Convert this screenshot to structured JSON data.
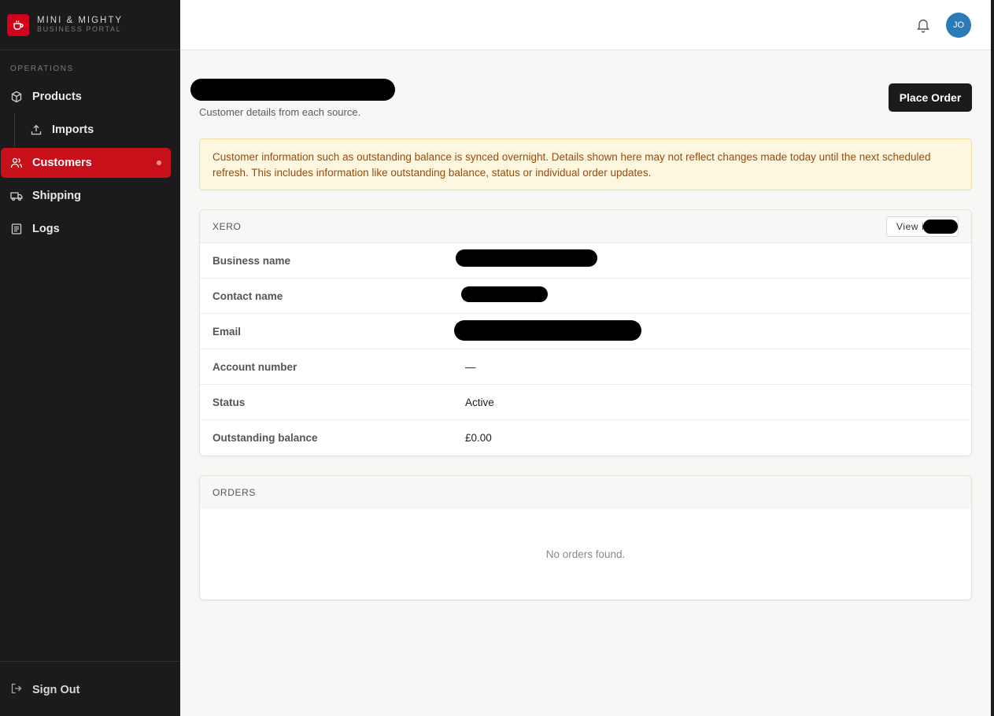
{
  "brand": {
    "title": "MINI & MIGHTY",
    "subtitle": "BUSINESS PORTAL"
  },
  "sidebar": {
    "section": "OPERATIONS",
    "items": [
      {
        "label": "Products",
        "icon": "box-icon"
      },
      {
        "label": "Imports",
        "icon": "upload-icon"
      },
      {
        "label": "Customers",
        "icon": "users-icon",
        "active": true
      },
      {
        "label": "Shipping",
        "icon": "truck-icon"
      },
      {
        "label": "Logs",
        "icon": "document-icon"
      }
    ],
    "sign_out": "Sign Out"
  },
  "topbar": {
    "avatar_initials": "JO"
  },
  "page": {
    "subtitle": "Customer details from each source.",
    "place_order_label": "Place Order"
  },
  "notice": "Customer information such as outstanding balance is synced overnight. Details shown here may not reflect changes made today until the next scheduled refresh. This includes information like outstanding balance, status or individual order updates.",
  "xero": {
    "heading": "XERO",
    "view_label": "View i",
    "rows": [
      {
        "label": "Business name",
        "value": ""
      },
      {
        "label": "Contact name",
        "value": ""
      },
      {
        "label": "Email",
        "value": ""
      },
      {
        "label": "Account number",
        "value": "—"
      },
      {
        "label": "Status",
        "value": "Active"
      },
      {
        "label": "Outstanding balance",
        "value": "£0.00"
      }
    ]
  },
  "orders": {
    "heading": "ORDERS",
    "empty_text": "No orders found."
  },
  "colors": {
    "accent": "#c8101a",
    "sidebar_bg": "#1b1b1d",
    "avatar_bg": "#2b7bb9"
  }
}
